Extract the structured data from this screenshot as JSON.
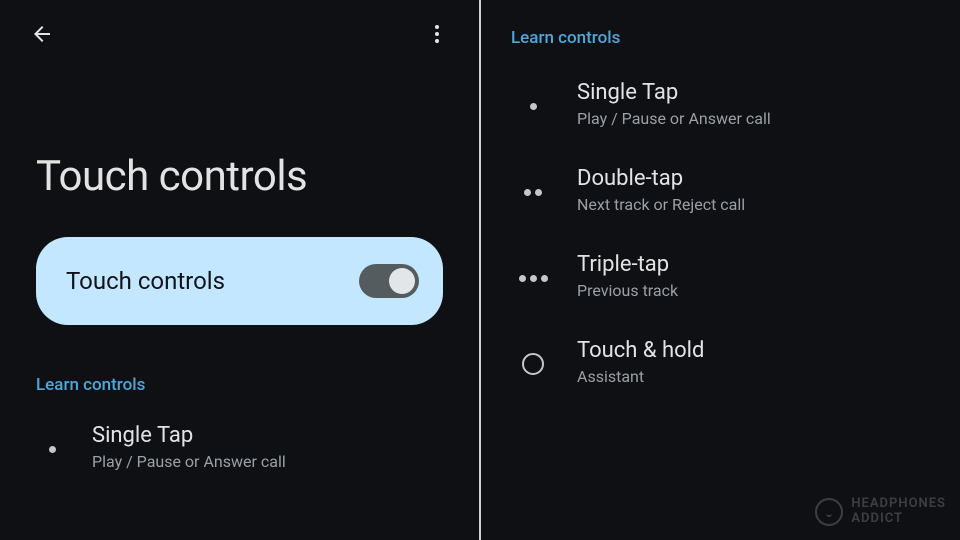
{
  "left": {
    "page_title": "Touch controls",
    "toggle": {
      "label": "Touch controls",
      "on": true
    },
    "section_header": "Learn controls",
    "gestures": [
      {
        "title": "Single Tap",
        "subtitle": "Play / Pause or Answer call",
        "icon": "single-dot"
      }
    ]
  },
  "right": {
    "section_header": "Learn controls",
    "gestures": [
      {
        "title": "Single Tap",
        "subtitle": "Play / Pause or Answer call",
        "icon": "single-dot"
      },
      {
        "title": "Double-tap",
        "subtitle": "Next track or Reject call",
        "icon": "double-dot"
      },
      {
        "title": "Triple-tap",
        "subtitle": "Previous track",
        "icon": "triple-dot"
      },
      {
        "title": "Touch & hold",
        "subtitle": "Assistant",
        "icon": "ring"
      }
    ]
  },
  "watermark": {
    "line1": "HEADPHONES",
    "line2": "ADDICT"
  }
}
